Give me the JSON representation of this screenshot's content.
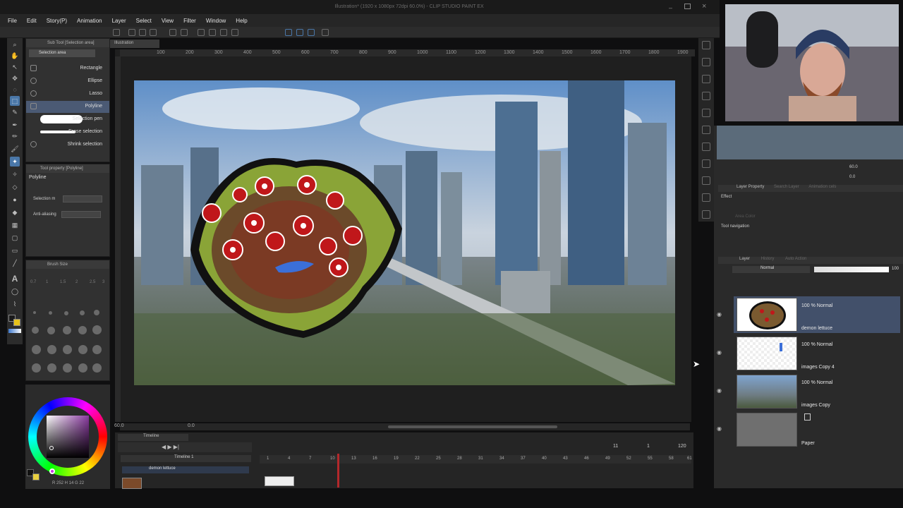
{
  "app": {
    "title": "Illustration* (1920 x 1080px 72dpi 60.0%) - CLIP STUDIO PAINT EX"
  },
  "menu": [
    "File",
    "Edit",
    "Story(P)",
    "Animation",
    "Layer",
    "Select",
    "View",
    "Filter",
    "Window",
    "Help"
  ],
  "doc_tab": "Illustration",
  "ruler_ticks": [
    "100",
    "200",
    "300",
    "400",
    "500",
    "600",
    "700",
    "800",
    "900",
    "1000",
    "1100",
    "1200",
    "1300",
    "1400",
    "1500",
    "1600",
    "1700",
    "1800",
    "1900"
  ],
  "subtool": {
    "header": "Sub Tool [Selection area]",
    "group_tab": "Selection area",
    "items": [
      "Rectangle",
      "Ellipse",
      "Lasso",
      "Polyline",
      "Selection pen",
      "Erase selection",
      "Shrink selection"
    ]
  },
  "tool_property": {
    "header": "Tool property [Polyline]",
    "name": "Polyline",
    "selection_label": "Selection m",
    "antialias_label": "Anti-aliasing"
  },
  "brush_size": {
    "header": "Brush Size",
    "values": [
      "0.7",
      "1",
      "1.5",
      "2",
      "2.5",
      "3"
    ]
  },
  "color": {
    "readout": "R 252 H 14 G 22"
  },
  "canvas": {
    "zoom": "60.0",
    "angle": "0.0"
  },
  "navigator": {
    "zoom": "60.0",
    "angle": "0.0"
  },
  "layer_property": {
    "tab": "Layer Property",
    "tab2": "Search Layer",
    "tab3": "Animation cels",
    "effect": "Effect",
    "area_color": "Area Color",
    "tool_navigation": "Tool navigation"
  },
  "layer_panel": {
    "tab": "Layer",
    "tab2": "History",
    "tab3": "Auto Action",
    "blend": "Normal",
    "opacity": "100",
    "layers": [
      {
        "mode": "100 % Normal",
        "name": "demon lettuce"
      },
      {
        "mode": "100 % Normal",
        "name": "images Copy 4"
      },
      {
        "mode": "100 % Normal",
        "name": "images Copy"
      },
      {
        "mode": "",
        "name": "Paper"
      }
    ]
  },
  "timeline": {
    "panel_tab": "Timeline",
    "name": "Timeline 1",
    "track": "demon lettuce",
    "frame_counter": [
      "11",
      "1",
      "120"
    ],
    "ticks": [
      "1",
      "4",
      "7",
      "10",
      "13",
      "16",
      "19",
      "22",
      "25",
      "28",
      "31",
      "34",
      "37",
      "40",
      "43",
      "46",
      "49",
      "52",
      "55",
      "58",
      "61"
    ]
  }
}
